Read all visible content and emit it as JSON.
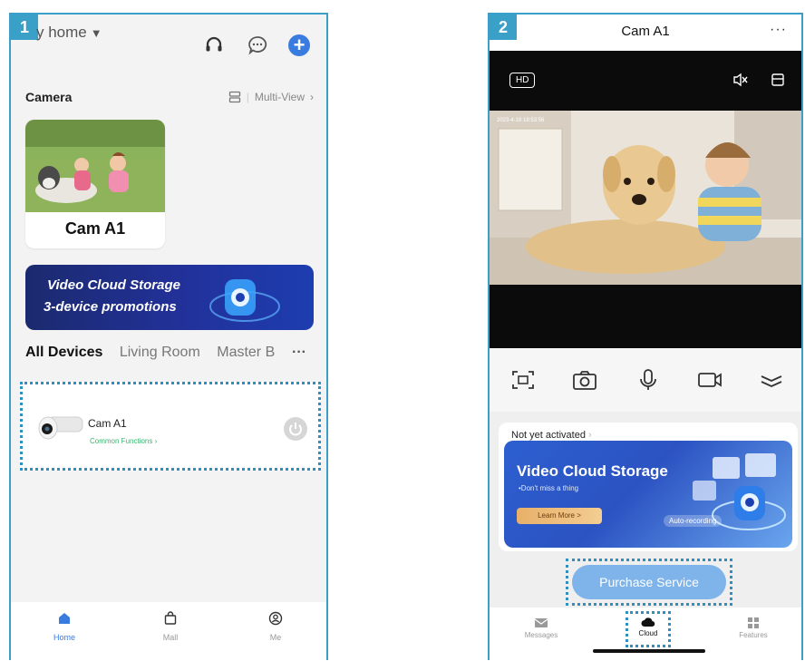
{
  "screen1": {
    "step": "1",
    "home_title": "y home",
    "camera_section": "Camera",
    "multi_view": "Multi-View",
    "camera_card_name": "Cam A1",
    "banner": {
      "line1": "Video Cloud Storage",
      "line2": "3-device promotions"
    },
    "tabs": [
      "All Devices",
      "Living Room",
      "Master B"
    ],
    "device": {
      "name": "Cam A1",
      "functions": "Common Functions"
    },
    "nav": [
      {
        "label": "Home"
      },
      {
        "label": "Mall"
      },
      {
        "label": "Me"
      }
    ],
    "colors": {
      "accent": "#3a7be0",
      "highlight": "#2e8fc0",
      "function_green": "#3bb46e"
    }
  },
  "screen2": {
    "step": "2",
    "title": "Cam A1",
    "hd": "HD",
    "timestamp": "2023-4-18 18:53:56",
    "not_activated": "Not yet activated",
    "banner": {
      "title": "Video Cloud Storage",
      "subtitle": "•Don't miss a thing",
      "learn_more": "Learn More >",
      "auto": "Auto-recording"
    },
    "purchase": "Purchase Service",
    "nav": [
      {
        "label": "Messages"
      },
      {
        "label": "Cloud"
      },
      {
        "label": "Features"
      }
    ]
  }
}
